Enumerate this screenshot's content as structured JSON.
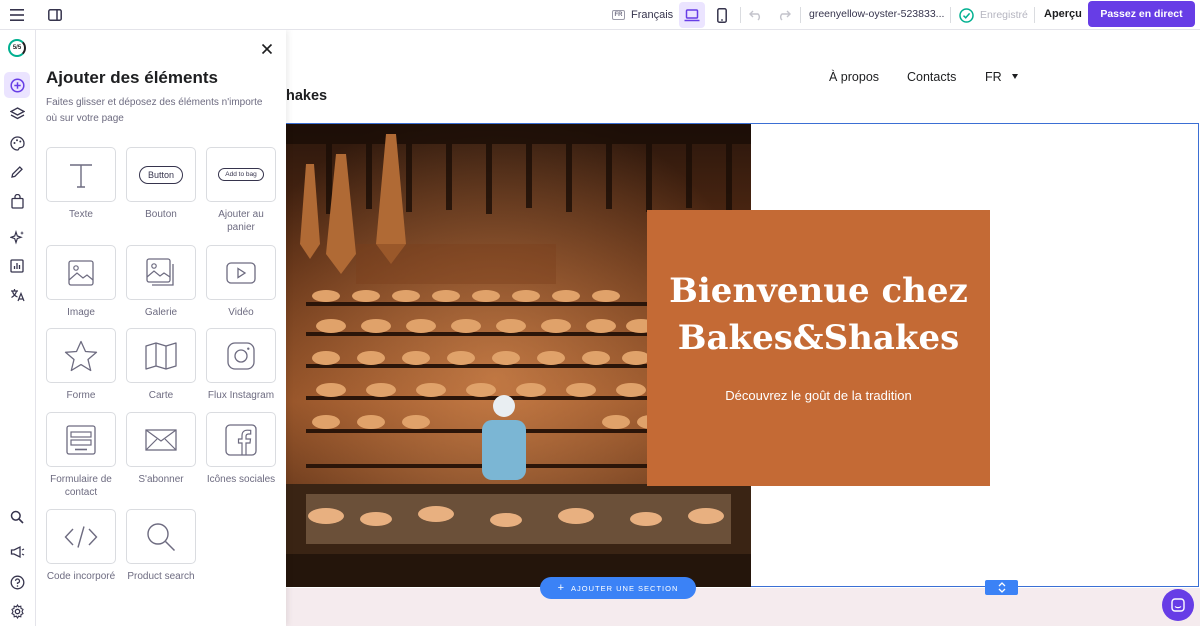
{
  "topbar": {
    "menu_icon": "hamburger-icon",
    "layout_icon": "sidebar-layout-icon",
    "language_flag": "FR",
    "language": "Français",
    "site_name": "greenyellow-oyster-523833...",
    "saved_label": "Enregistré",
    "preview_label": "Aperçu",
    "publish_label": "Passez en direct"
  },
  "rail": {
    "logo_text": "5/5"
  },
  "panel": {
    "title": "Ajouter des éléments",
    "description": "Faites glisser et déposez des éléments n'importe où sur votre page",
    "tiles": [
      {
        "label": "Texte",
        "icon": "text-icon"
      },
      {
        "label": "Bouton",
        "icon": "button-icon",
        "preview": "Button"
      },
      {
        "label": "Ajouter au panier",
        "icon": "add-to-bag-icon",
        "preview": "Add to bag"
      },
      {
        "label": "Image",
        "icon": "image-icon"
      },
      {
        "label": "Galerie",
        "icon": "gallery-icon"
      },
      {
        "label": "Vidéo",
        "icon": "video-icon"
      },
      {
        "label": "Forme",
        "icon": "star-shape-icon"
      },
      {
        "label": "Carte",
        "icon": "map-icon"
      },
      {
        "label": "Flux Instagram",
        "icon": "instagram-icon"
      },
      {
        "label": "Formulaire de contact",
        "icon": "contact-form-icon"
      },
      {
        "label": "S'abonner",
        "icon": "envelope-icon"
      },
      {
        "label": "Icônes sociales",
        "icon": "facebook-icon"
      },
      {
        "label": "Code incorporé",
        "icon": "code-icon"
      },
      {
        "label": "Product search",
        "icon": "search-icon"
      }
    ]
  },
  "site": {
    "logo_fragment": "hakes",
    "nav": [
      "À propos",
      "Contacts",
      "FR"
    ],
    "hero_title_line1": "Bienvenue chez",
    "hero_title_line2": "Bakes&Shakes",
    "hero_subtitle": "Découvrez le goût de la tradition",
    "add_section_label": "AJOUTER UNE SECTION"
  },
  "colors": {
    "accent": "#673de6",
    "hero_box": "#c46a35",
    "selection": "#3b6fd4",
    "section_bg": "#f5ebee"
  }
}
